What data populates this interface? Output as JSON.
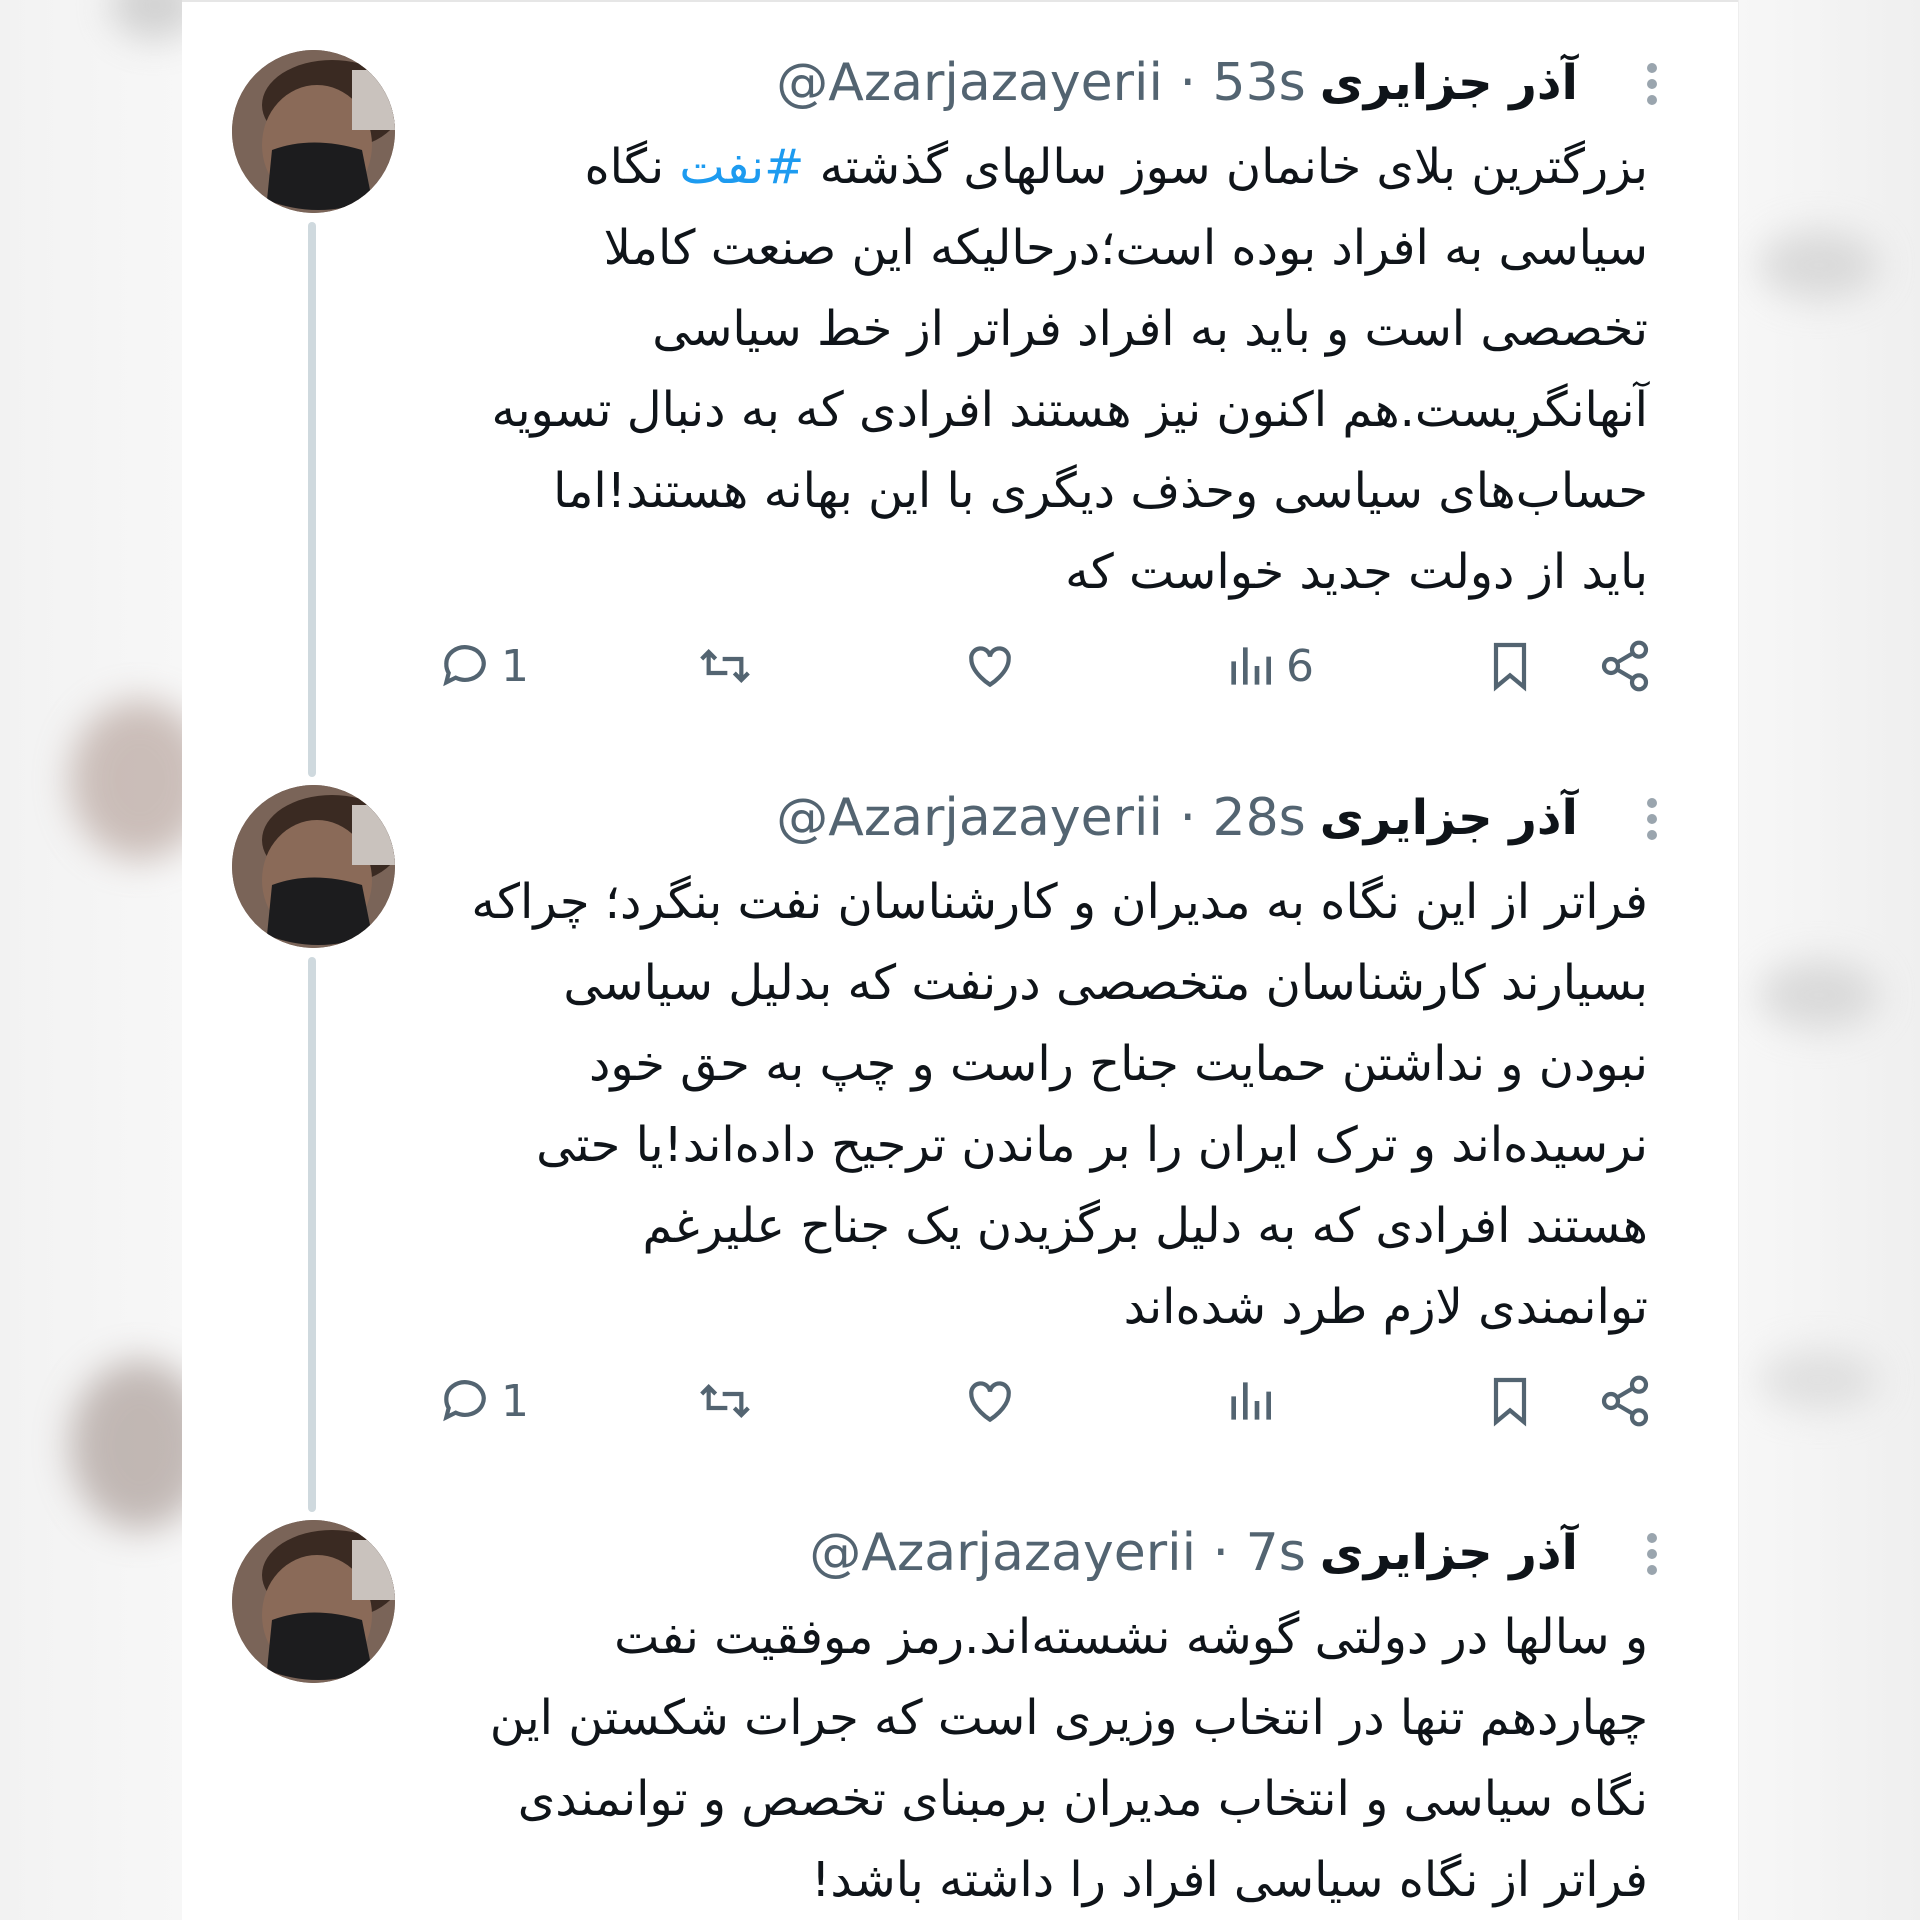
{
  "tweets": [
    {
      "name": "آذر جزایری",
      "handle": "@Azarjazayerii",
      "time": "· 53s",
      "lines": [
        "بزرگترین بلای خانمان سوز سالهای گذشته",
        "سیاسی به افراد بوده است؛درحالیکه این صنعت کاملا",
        "تخصصی است و باید به افراد فراتر از خط سیاسی",
        "آنهانگریست.هم اکنون نیز هستند افرادی که به دنبال تسویه",
        "حساب‌های سیاسی وحذف دیگری با این بهانه هستند!اما",
        "باید از دولت جدید خواست که"
      ],
      "hashtag": "#نفت",
      "line1_tail": " نگاه",
      "replies": "1",
      "views": "6"
    },
    {
      "name": "آذر جزایری",
      "handle": "@Azarjazayerii",
      "time": "· 28s",
      "lines": [
        "فراتر از این نگاه  به مدیران و کارشناسان نفت بنگرد؛ چراکه",
        "بسیارند کارشناسان متخصصی درنفت که بدلیل سیاسی",
        "نبودن و نداشتن حمایت جناح راست و چپ به حق خود",
        "نرسیده‌اند و ترک ایران را بر ماندن ترجیح داده‌اند!یا حتی",
        "هستند افرادی که به دلیل برگزیدن یک جناح علیرغم",
        "توانمندی لازم طرد شده‌اند"
      ],
      "replies": "1",
      "views": ""
    },
    {
      "name": "آذر جزایری",
      "handle": "@Azarjazayerii",
      "time": "· 7s",
      "lines": [
        "و سالها در دولتی گوشه نشسته‌اند.رمز موفقیت نفت",
        "چهاردهم تنها در انتخاب وزیری است که جرات شکستن این",
        "نگاه سیاسی و انتخاب مدیران برمبنای تخصص و توانمندی",
        "فراتر از نگاه سیاسی افراد را داشته باشد!"
      ]
    }
  ],
  "icons": [
    "reply-icon",
    "retweet-icon",
    "like-icon",
    "views-icon",
    "bookmark-icon",
    "share-icon",
    "more-icon"
  ],
  "colors": {
    "hashtag": "#1d9bf0",
    "text": "#0f1419",
    "muted": "#536471",
    "thread_line": "#cfd9de"
  }
}
